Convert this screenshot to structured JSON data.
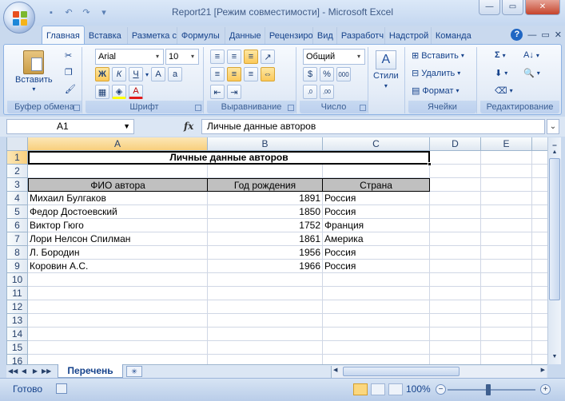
{
  "window": {
    "title": "Report21  [Режим совместимости] - Microsoft Excel",
    "controls": [
      "minimize",
      "maximize",
      "close"
    ]
  },
  "quick_access": [
    "save-icon",
    "undo-icon",
    "redo-icon",
    "customize-icon"
  ],
  "ribbon_tabs": [
    {
      "label": "Главная",
      "active": true
    },
    {
      "label": "Вставка"
    },
    {
      "label": "Разметка с"
    },
    {
      "label": "Формулы"
    },
    {
      "label": "Данные"
    },
    {
      "label": "Рецензиро"
    },
    {
      "label": "Вид"
    },
    {
      "label": "Разработч"
    },
    {
      "label": "Надстрой"
    },
    {
      "label": "Команда"
    }
  ],
  "ribbon": {
    "clipboard": {
      "paste_label": "Вставить",
      "group_label": "Буфер обмена"
    },
    "font": {
      "name": "Arial",
      "size": "10",
      "group_label": "Шрифт",
      "bold": "Ж",
      "italic": "К",
      "underline": "Ч"
    },
    "alignment": {
      "group_label": "Выравнивание"
    },
    "number": {
      "format": "Общий",
      "group_label": "Число"
    },
    "styles": {
      "label": "Стили"
    },
    "cells": {
      "insert": "Вставить",
      "delete": "Удалить",
      "format": "Формат",
      "group_label": "Ячейки"
    },
    "editing": {
      "group_label": "Редактирование"
    }
  },
  "formula_bar": {
    "name_box": "A1",
    "fx": "fx",
    "formula": "Личные данные авторов"
  },
  "columns": [
    "A",
    "B",
    "C",
    "D",
    "E"
  ],
  "rows": [
    "1",
    "2",
    "3",
    "4",
    "5",
    "6",
    "7",
    "8",
    "9",
    "10",
    "11",
    "12",
    "13",
    "14",
    "15",
    "16"
  ],
  "sheet": {
    "title": "Личные данные авторов",
    "headers": [
      "ФИО автора",
      "Год рождения",
      "Страна"
    ],
    "records": [
      {
        "name": "Михаил Булгаков",
        "year": "1891",
        "country": "Россия"
      },
      {
        "name": "Федор Достоевский",
        "year": "1850",
        "country": "Россия"
      },
      {
        "name": "Виктор Гюго",
        "year": "1752",
        "country": "Франция"
      },
      {
        "name": "Лори Нелсон Спилман",
        "year": "1861",
        "country": "Америка"
      },
      {
        "name": "Л. Бородин",
        "year": "1956",
        "country": "Россия"
      },
      {
        "name": "Коровин А.С.",
        "year": "1966",
        "country": "Россия"
      }
    ]
  },
  "sheet_tabs": {
    "active": "Перечень"
  },
  "status": {
    "ready": "Готово",
    "zoom": "100%"
  },
  "colors": {
    "header_fill": "#c0c0c0",
    "ribbon_text": "#15428b",
    "selection": "#f8cf7d"
  }
}
